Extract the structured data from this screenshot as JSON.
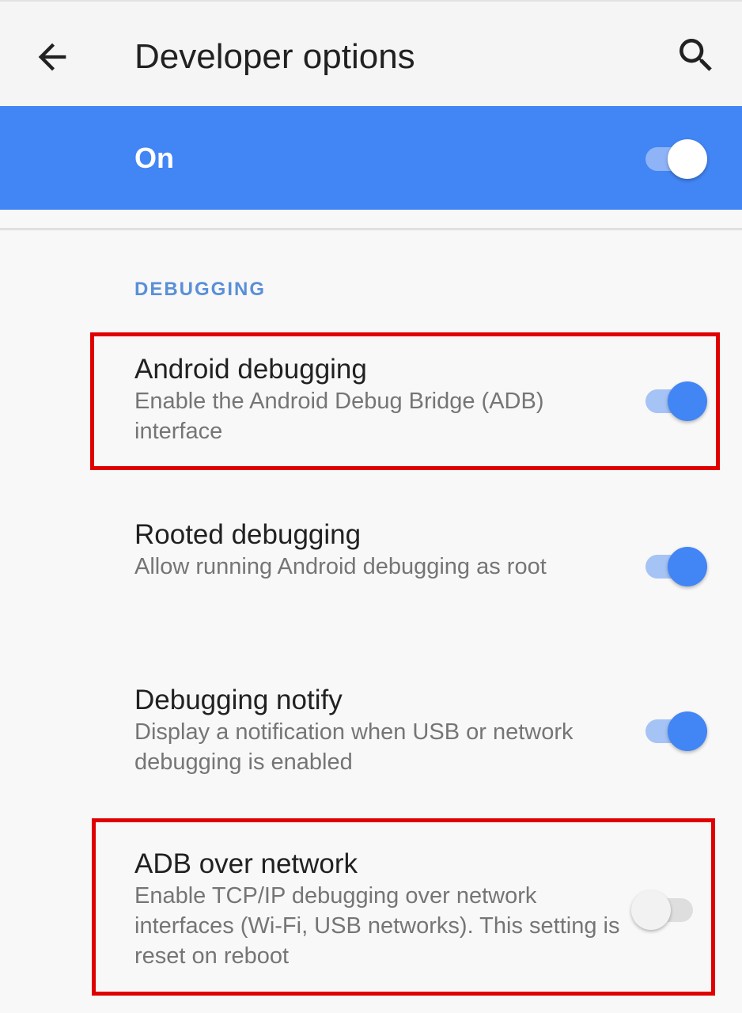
{
  "header": {
    "title": "Developer options",
    "back_icon": "arrow-back-icon",
    "search_icon": "search-icon"
  },
  "master_switch": {
    "label": "On",
    "checked": true
  },
  "section": {
    "header": "DEBUGGING"
  },
  "settings": [
    {
      "title": "Android debugging",
      "summary": "Enable the Android Debug Bridge (ADB) interface",
      "checked": true,
      "highlighted": true
    },
    {
      "title": "Rooted debugging",
      "summary": "Allow running Android debugging as root",
      "checked": true,
      "highlighted": false
    },
    {
      "title": "Debugging notify",
      "summary": "Display a notification when USB or network debugging is enabled",
      "checked": true,
      "highlighted": false
    },
    {
      "title": "ADB over network",
      "summary": "Enable TCP/IP debugging over network interfaces (Wi-Fi, USB networks). This setting is reset on reboot",
      "checked": false,
      "highlighted": true
    }
  ],
  "colors": {
    "accent": "#4285f4",
    "highlight_border": "#e00000",
    "section_header": "#5a8fd8"
  }
}
